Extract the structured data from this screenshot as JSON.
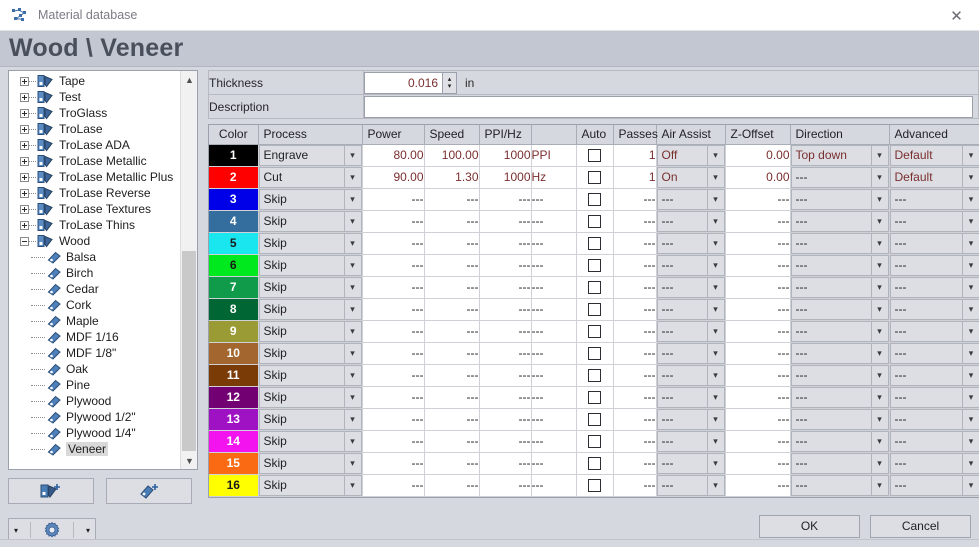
{
  "window": {
    "title": "Material database",
    "app_icon": "material-database-icon",
    "close_label": "✕"
  },
  "header": {
    "page_title": "Wood \\ Veneer"
  },
  "sidebar": {
    "scroll_up": "▲",
    "scroll_down": "▼",
    "items": [
      {
        "label": "Tape",
        "expanded": false,
        "level": 0
      },
      {
        "label": "Test",
        "expanded": false,
        "level": 0
      },
      {
        "label": "TroGlass",
        "expanded": false,
        "level": 0
      },
      {
        "label": "TroLase",
        "expanded": false,
        "level": 0
      },
      {
        "label": "TroLase ADA",
        "expanded": false,
        "level": 0
      },
      {
        "label": "TroLase Metallic",
        "expanded": false,
        "level": 0
      },
      {
        "label": "TroLase Metallic Plus",
        "expanded": false,
        "level": 0
      },
      {
        "label": "TroLase Reverse",
        "expanded": false,
        "level": 0
      },
      {
        "label": "TroLase Textures",
        "expanded": false,
        "level": 0
      },
      {
        "label": "TroLase Thins",
        "expanded": false,
        "level": 0
      },
      {
        "label": "Wood",
        "expanded": true,
        "level": 0
      },
      {
        "label": "Balsa",
        "level": 1
      },
      {
        "label": "Birch",
        "level": 1
      },
      {
        "label": "Cedar",
        "level": 1
      },
      {
        "label": "Cork",
        "level": 1
      },
      {
        "label": "Maple",
        "level": 1
      },
      {
        "label": "MDF 1/16",
        "level": 1
      },
      {
        "label": "MDF 1/8\"",
        "level": 1
      },
      {
        "label": "Oak",
        "level": 1
      },
      {
        "label": "Pine",
        "level": 1
      },
      {
        "label": "Plywood",
        "level": 1
      },
      {
        "label": "Plywood 1/2\"",
        "level": 1
      },
      {
        "label": "Plywood 1/4\"",
        "level": 1
      },
      {
        "label": "Veneer",
        "level": 1,
        "selected": true
      }
    ],
    "buttons": [
      {
        "name": "new-material-group-button",
        "icon": "add-material-group-icon"
      },
      {
        "name": "new-material-button",
        "icon": "add-material-icon"
      }
    ],
    "gear_bar": {
      "left_caret": "▾",
      "icon": "gear-icon",
      "right_caret": "▾"
    }
  },
  "fields": {
    "thickness": {
      "label": "Thickness",
      "value": "0.016",
      "unit": "in",
      "spin_up": "▴",
      "spin_down": "▾"
    },
    "description": {
      "label": "Description",
      "value": "",
      "placeholder": ""
    }
  },
  "grid": {
    "columns": [
      "Color",
      "Process",
      "Power",
      "Speed",
      "PPI/Hz",
      "",
      "Auto",
      "Passes",
      "Air Assist",
      "Z-Offset",
      "Direction",
      "Advanced"
    ],
    "dash": "---",
    "rows": [
      {
        "index": "1",
        "color": "#000000",
        "text_color": "#ffffff",
        "process": "Engrave",
        "power": "80.00",
        "speed": "100.00",
        "ppi": "1000",
        "unit": "PPI",
        "auto": false,
        "passes": "1",
        "air": "Off",
        "zoffset": "0.00",
        "direction": "Top down",
        "advanced": "Default"
      },
      {
        "index": "2",
        "color": "#ff0000",
        "text_color": "#ffffff",
        "process": "Cut",
        "power": "90.00",
        "speed": "1.30",
        "ppi": "1000",
        "unit": "Hz",
        "auto": false,
        "passes": "1",
        "air": "On",
        "zoffset": "0.00",
        "direction": "---",
        "advanced": "Default"
      },
      {
        "index": "3",
        "color": "#0000e8",
        "text_color": "#ffffff",
        "process": "Skip",
        "power": "---",
        "speed": "---",
        "ppi": "---",
        "unit": "---",
        "auto": false,
        "passes": "---",
        "air": "---",
        "zoffset": "---",
        "direction": "---",
        "advanced": "---"
      },
      {
        "index": "4",
        "color": "#336e9e",
        "text_color": "#ffffff",
        "process": "Skip",
        "power": "---",
        "speed": "---",
        "ppi": "---",
        "unit": "---",
        "auto": false,
        "passes": "---",
        "air": "---",
        "zoffset": "---",
        "direction": "---",
        "advanced": "---"
      },
      {
        "index": "5",
        "color": "#1ae6f0",
        "text_color": "#1a1a1a",
        "process": "Skip",
        "power": "---",
        "speed": "---",
        "ppi": "---",
        "unit": "---",
        "auto": false,
        "passes": "---",
        "air": "---",
        "zoffset": "---",
        "direction": "---",
        "advanced": "---"
      },
      {
        "index": "6",
        "color": "#00e81e",
        "text_color": "#1a1a1a",
        "process": "Skip",
        "power": "---",
        "speed": "---",
        "ppi": "---",
        "unit": "---",
        "auto": false,
        "passes": "---",
        "air": "---",
        "zoffset": "---",
        "direction": "---",
        "advanced": "---"
      },
      {
        "index": "7",
        "color": "#0f9b4a",
        "text_color": "#ffffff",
        "process": "Skip",
        "power": "---",
        "speed": "---",
        "ppi": "---",
        "unit": "---",
        "auto": false,
        "passes": "---",
        "air": "---",
        "zoffset": "---",
        "direction": "---",
        "advanced": "---"
      },
      {
        "index": "8",
        "color": "#006633",
        "text_color": "#ffffff",
        "process": "Skip",
        "power": "---",
        "speed": "---",
        "ppi": "---",
        "unit": "---",
        "auto": false,
        "passes": "---",
        "air": "---",
        "zoffset": "---",
        "direction": "---",
        "advanced": "---"
      },
      {
        "index": "9",
        "color": "#9a9b34",
        "text_color": "#ffffff",
        "process": "Skip",
        "power": "---",
        "speed": "---",
        "ppi": "---",
        "unit": "---",
        "auto": false,
        "passes": "---",
        "air": "---",
        "zoffset": "---",
        "direction": "---",
        "advanced": "---"
      },
      {
        "index": "10",
        "color": "#a3662e",
        "text_color": "#ffffff",
        "process": "Skip",
        "power": "---",
        "speed": "---",
        "ppi": "---",
        "unit": "---",
        "auto": false,
        "passes": "---",
        "air": "---",
        "zoffset": "---",
        "direction": "---",
        "advanced": "---"
      },
      {
        "index": "11",
        "color": "#7a3b06",
        "text_color": "#ffffff",
        "process": "Skip",
        "power": "---",
        "speed": "---",
        "ppi": "---",
        "unit": "---",
        "auto": false,
        "passes": "---",
        "air": "---",
        "zoffset": "---",
        "direction": "---",
        "advanced": "---"
      },
      {
        "index": "12",
        "color": "#720072",
        "text_color": "#ffffff",
        "process": "Skip",
        "power": "---",
        "speed": "---",
        "ppi": "---",
        "unit": "---",
        "auto": false,
        "passes": "---",
        "air": "---",
        "zoffset": "---",
        "direction": "---",
        "advanced": "---"
      },
      {
        "index": "13",
        "color": "#9e12c4",
        "text_color": "#ffffff",
        "process": "Skip",
        "power": "---",
        "speed": "---",
        "ppi": "---",
        "unit": "---",
        "auto": false,
        "passes": "---",
        "air": "---",
        "zoffset": "---",
        "direction": "---",
        "advanced": "---"
      },
      {
        "index": "14",
        "color": "#f213ef",
        "text_color": "#ffffff",
        "process": "Skip",
        "power": "---",
        "speed": "---",
        "ppi": "---",
        "unit": "---",
        "auto": false,
        "passes": "---",
        "air": "---",
        "zoffset": "---",
        "direction": "---",
        "advanced": "---"
      },
      {
        "index": "15",
        "color": "#f96a12",
        "text_color": "#ffffff",
        "process": "Skip",
        "power": "---",
        "speed": "---",
        "ppi": "---",
        "unit": "---",
        "auto": false,
        "passes": "---",
        "air": "---",
        "zoffset": "---",
        "direction": "---",
        "advanced": "---"
      },
      {
        "index": "16",
        "color": "#ffff00",
        "text_color": "#1a1a1a",
        "process": "Skip",
        "power": "---",
        "speed": "---",
        "ppi": "---",
        "unit": "---",
        "auto": false,
        "passes": "---",
        "air": "---",
        "zoffset": "---",
        "direction": "---",
        "advanced": "---"
      }
    ]
  },
  "footer": {
    "ok_label": "OK",
    "cancel_label": "Cancel"
  },
  "colors": {
    "accent": "#3d6ea8",
    "window_bg": "#d6d8e0",
    "header_band": "#c3c7d1",
    "value_text": "#7a2e2e"
  }
}
